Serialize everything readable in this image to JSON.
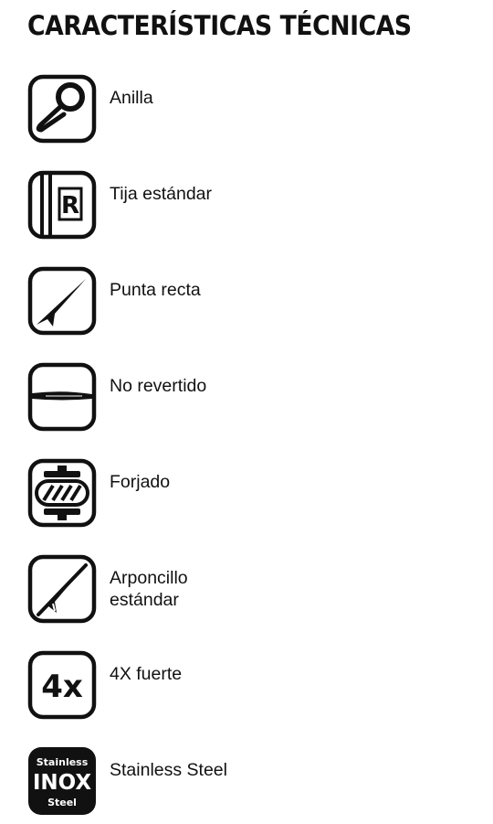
{
  "section": {
    "title": "CARACTERÍSTICAS TÉCNICAS"
  },
  "features": [
    {
      "label": "Anilla",
      "icon": "eye-ring-icon"
    },
    {
      "label": "Tija estándar",
      "icon": "standard-shank-icon"
    },
    {
      "label": "Punta recta",
      "icon": "straight-point-icon"
    },
    {
      "label": "No revertido",
      "icon": "not-reversed-icon"
    },
    {
      "label": "Forjado",
      "icon": "forged-icon"
    },
    {
      "label": "Arponcillo\nestándar",
      "icon": "standard-barb-icon"
    },
    {
      "label": "4X fuerte",
      "icon": "4x-strong-icon"
    },
    {
      "label": "Stainless Steel",
      "icon": "stainless-steel-icon",
      "badge": {
        "top": "Stainless",
        "middle": "INOX",
        "bottom": "Steel"
      }
    }
  ]
}
